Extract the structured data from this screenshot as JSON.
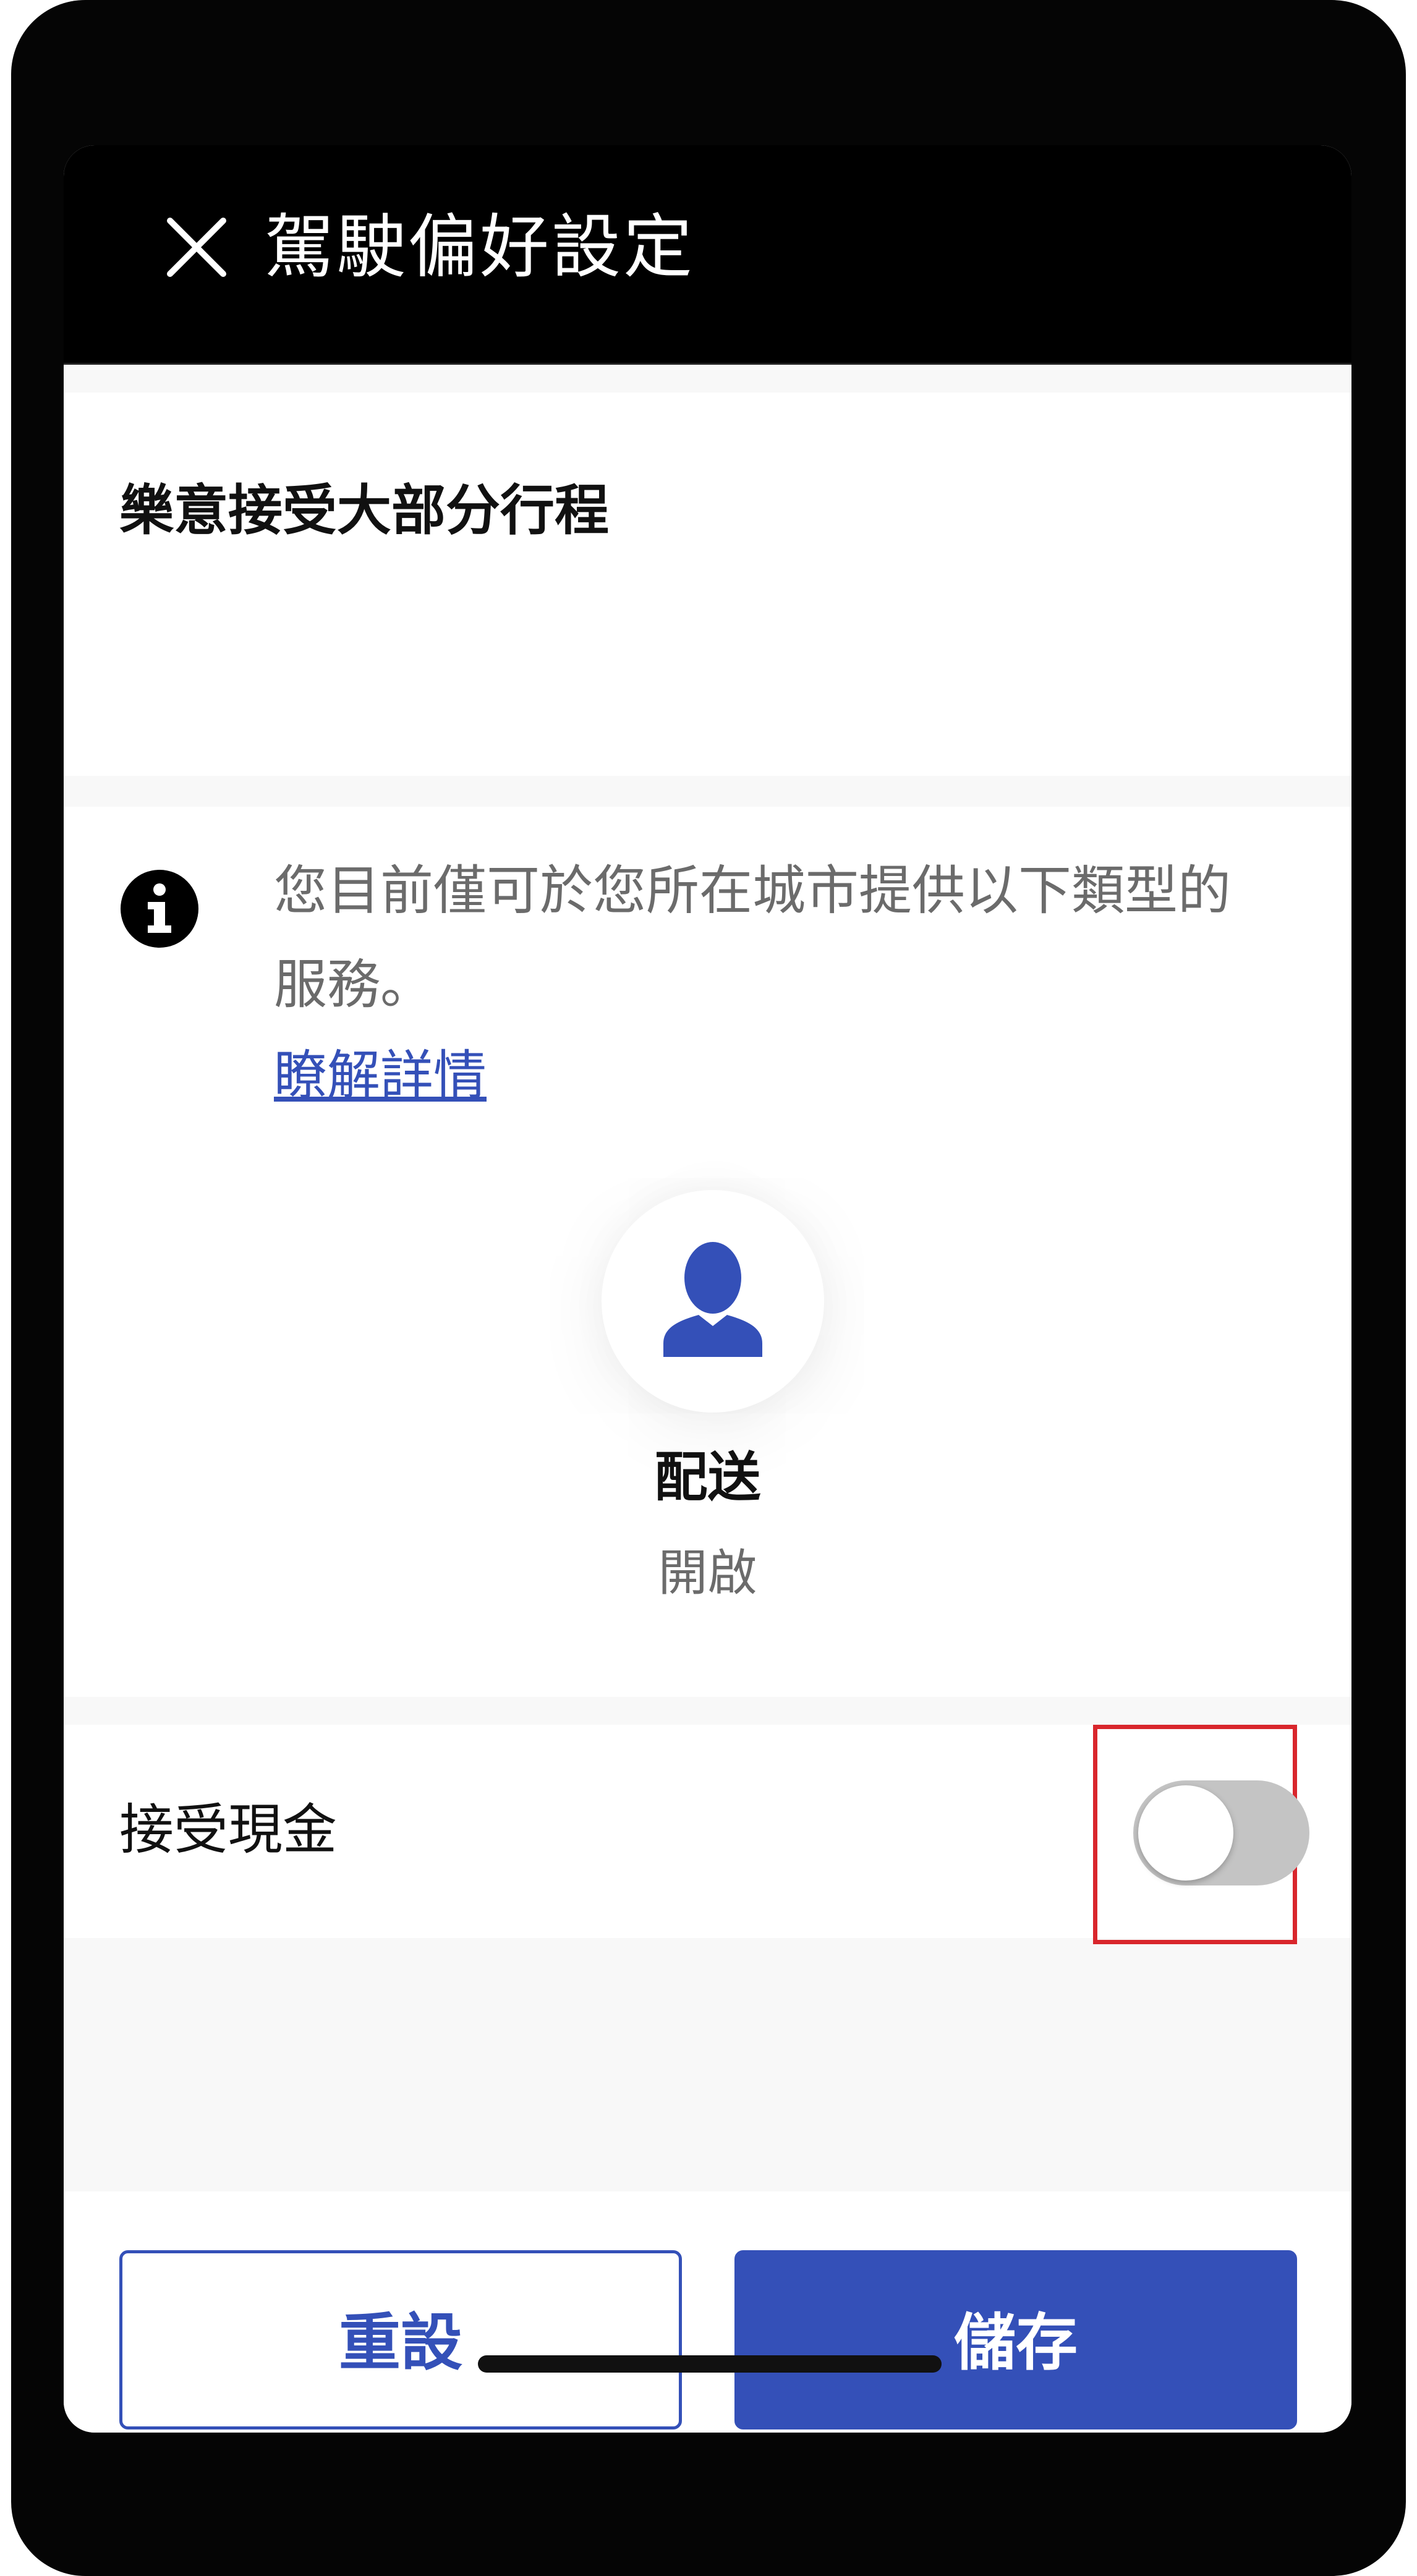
{
  "header": {
    "title": "駕駛偏好設定",
    "close_icon": "close-icon"
  },
  "trips_section": {
    "title": "樂意接受大部分行程"
  },
  "info_section": {
    "icon": "info-icon",
    "message": "您目前僅可於您所在城市提供以下類型的服務。",
    "learn_more_link": "瞭解詳情"
  },
  "service": {
    "icon": "person-icon",
    "name": "配送",
    "status": "開啟"
  },
  "cash_section": {
    "label": "接受現金",
    "toggle_on": false
  },
  "footer": {
    "reset_label": "重設",
    "save_label": "儲存"
  },
  "colors": {
    "accent": "#3450b8",
    "highlight": "#d9262c",
    "toggle_off": "#c4c4c4"
  }
}
